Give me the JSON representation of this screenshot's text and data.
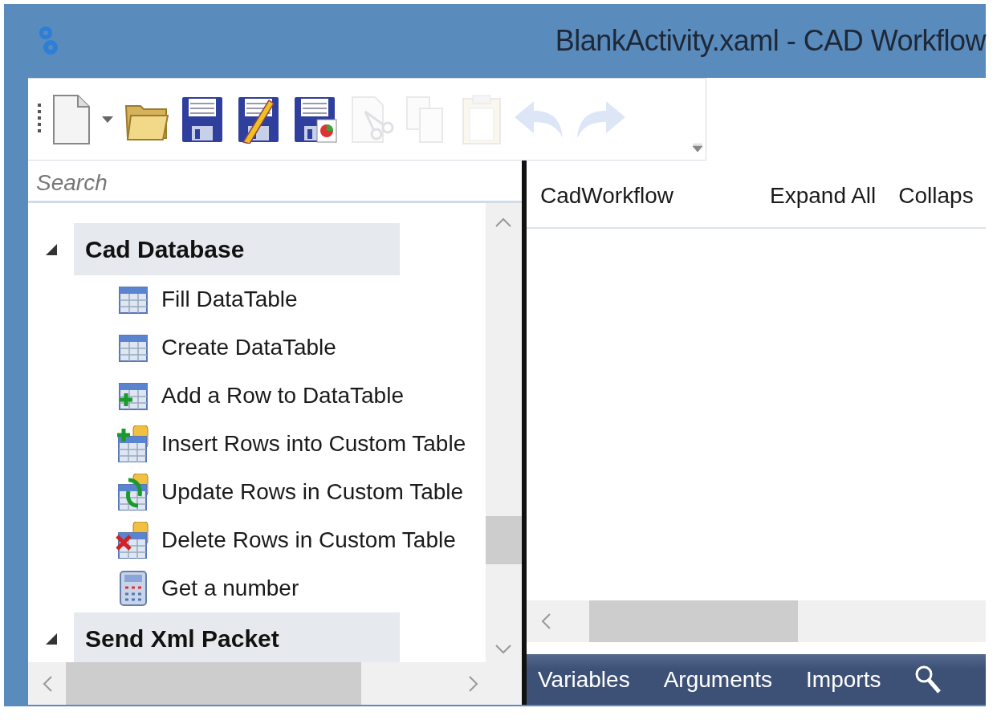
{
  "window": {
    "title": "BlankActivity.xaml - CAD Workflow"
  },
  "toolbar": [
    {
      "kind": "new",
      "disabled": false
    },
    {
      "kind": "dropdown",
      "disabled": false
    },
    {
      "kind": "open",
      "disabled": false
    },
    {
      "kind": "save",
      "disabled": false
    },
    {
      "kind": "save-as",
      "disabled": false
    },
    {
      "kind": "save-report",
      "disabled": false
    },
    {
      "kind": "cut",
      "disabled": true
    },
    {
      "kind": "copy",
      "disabled": true
    },
    {
      "kind": "paste",
      "disabled": true
    },
    {
      "kind": "undo",
      "disabled": true
    },
    {
      "kind": "redo",
      "disabled": true
    }
  ],
  "toolbox": {
    "search": {
      "placeholder": "Search"
    },
    "sections": [
      {
        "label": "Cad Database",
        "expanded": true,
        "children": [
          {
            "label": "Fill DataTable",
            "kind": "table"
          },
          {
            "label": "Create DataTable",
            "kind": "table"
          },
          {
            "label": "Add a Row to DataTable",
            "kind": "table-add"
          },
          {
            "label": "Insert Rows into Custom Table",
            "kind": "db-insert"
          },
          {
            "label": "Update Rows in Custom Table",
            "kind": "db-update"
          },
          {
            "label": "Delete Rows in Custom Table",
            "kind": "db-delete"
          },
          {
            "label": "Get a number",
            "kind": "calculator"
          }
        ]
      },
      {
        "label": "Send Xml Packet",
        "expanded": true
      }
    ]
  },
  "designer": {
    "breadcrumb": "CadWorkflow",
    "actions": [
      "Expand All",
      "Collaps"
    ]
  },
  "bottom_tabs": [
    "Variables",
    "Arguments",
    "Imports"
  ]
}
